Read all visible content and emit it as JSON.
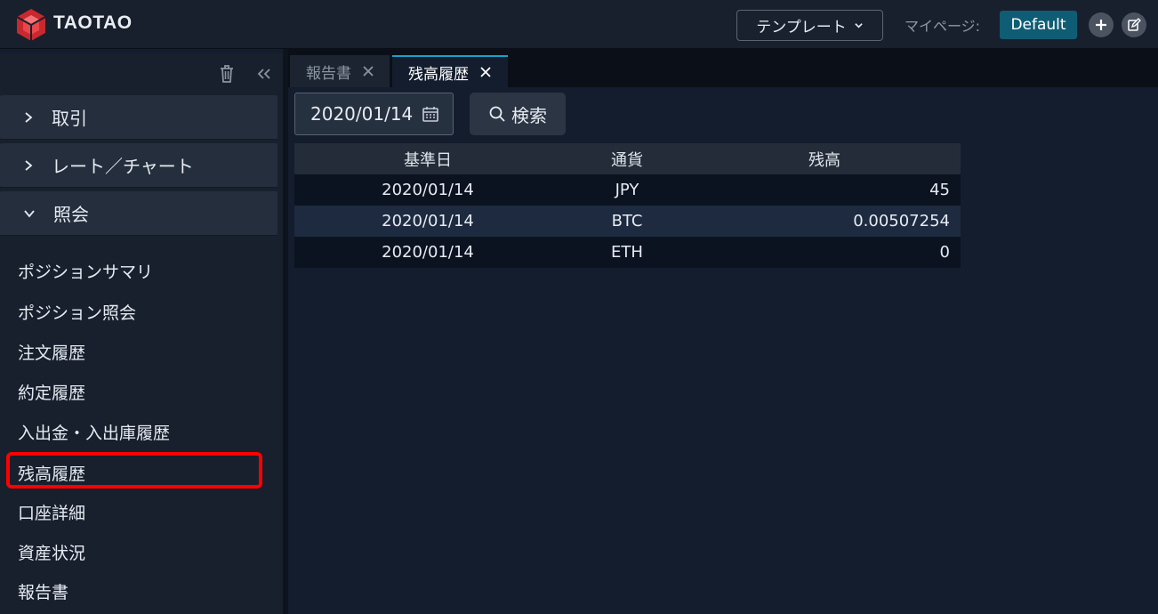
{
  "header": {
    "logo_text": "TAOTAO",
    "template_label": "テンプレート",
    "mypage_label": "マイページ:",
    "default_badge": "Default",
    "icons": [
      "add-icon",
      "edit-icon"
    ]
  },
  "sidebar": {
    "accordions": [
      {
        "label": "取引",
        "state": "collapsed"
      },
      {
        "label": "レート／チャート",
        "state": "collapsed"
      },
      {
        "label": "照会",
        "state": "expanded"
      }
    ],
    "items": [
      {
        "label": "ポジションサマリ"
      },
      {
        "label": "ポジション照会"
      },
      {
        "label": "注文履歴"
      },
      {
        "label": "約定履歴"
      },
      {
        "label": "入出金・入出庫履歴"
      },
      {
        "label": "残高履歴",
        "highlighted": true
      },
      {
        "label": "口座詳細"
      },
      {
        "label": "資産状況"
      },
      {
        "label": "報告書"
      }
    ]
  },
  "tabs": [
    {
      "label": "報告書",
      "active": false
    },
    {
      "label": "残高履歴",
      "active": true
    }
  ],
  "filter": {
    "date_value": "2020/01/14",
    "search_label": "検索"
  },
  "table": {
    "headers": [
      "基準日",
      "通貨",
      "残高"
    ],
    "rows": [
      [
        "2020/01/14",
        "JPY",
        "45"
      ],
      [
        "2020/01/14",
        "BTC",
        "0.00507254"
      ],
      [
        "2020/01/14",
        "ETH",
        "0"
      ]
    ]
  },
  "colors": {
    "background": "#131d2d",
    "panel": "#18202d",
    "accent": "#18a3c9",
    "default_badge": "#0f5d74",
    "highlight": "#ff0000"
  }
}
